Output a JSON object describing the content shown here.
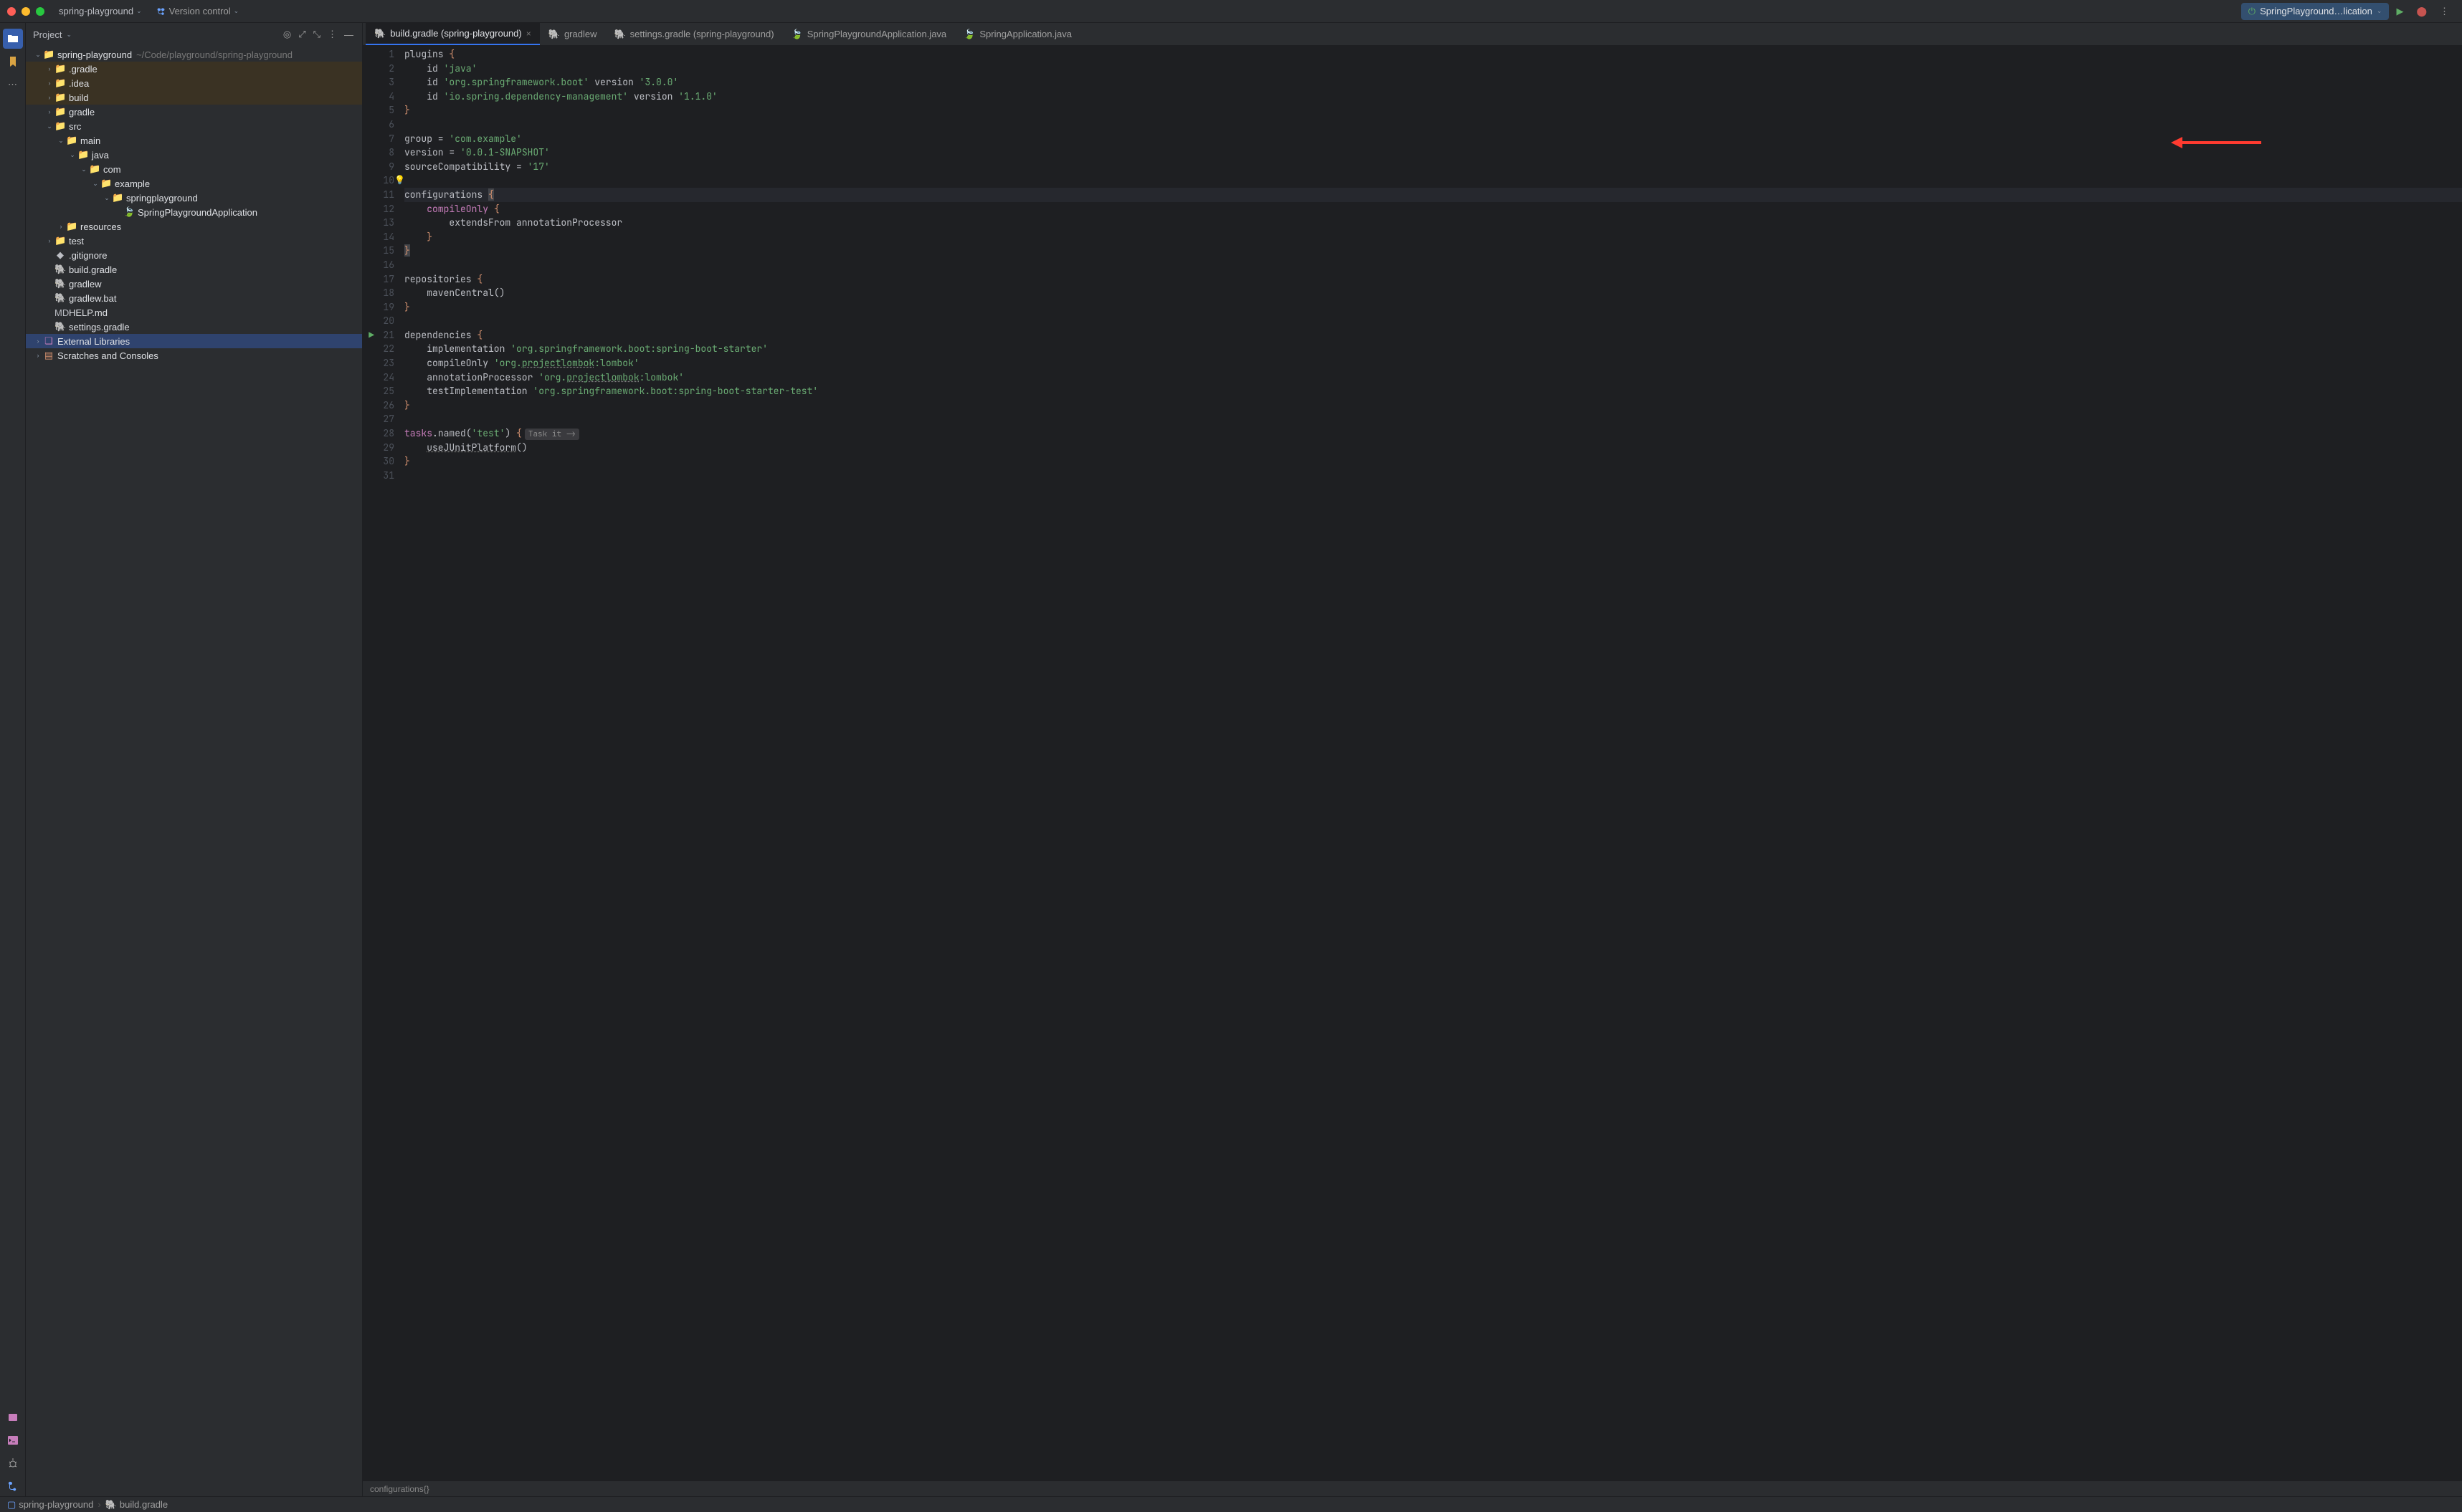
{
  "topbar": {
    "project_name": "spring-playground",
    "vcs_label": "Version control",
    "run_config": "SpringPlayground…lication"
  },
  "project_panel": {
    "title": "Project",
    "root": {
      "label": "spring-playground",
      "path": "~/Code/playground/spring-playground"
    },
    "nodes": [
      {
        "indent": 1,
        "arrow": "right",
        "icon": "📁",
        "label": ".gradle",
        "hl": true
      },
      {
        "indent": 1,
        "arrow": "right",
        "icon": "📁",
        "label": ".idea",
        "hl": true
      },
      {
        "indent": 1,
        "arrow": "right",
        "icon": "📁",
        "label": "build",
        "hl": true
      },
      {
        "indent": 1,
        "arrow": "right",
        "icon": "📁",
        "label": "gradle"
      },
      {
        "indent": 1,
        "arrow": "down",
        "icon": "📁",
        "label": "src"
      },
      {
        "indent": 2,
        "arrow": "down",
        "icon": "📁",
        "label": "main"
      },
      {
        "indent": 3,
        "arrow": "down",
        "icon": "📁",
        "label": "java"
      },
      {
        "indent": 4,
        "arrow": "down",
        "icon": "📁",
        "label": "com"
      },
      {
        "indent": 5,
        "arrow": "down",
        "icon": "📁",
        "label": "example"
      },
      {
        "indent": 6,
        "arrow": "down",
        "icon": "📁",
        "label": "springplayground"
      },
      {
        "indent": 7,
        "arrow": "none",
        "icon": "🍃",
        "label": "SpringPlaygroundApplication"
      },
      {
        "indent": 2,
        "arrow": "right",
        "icon": "📁",
        "label": "resources"
      },
      {
        "indent": 1,
        "arrow": "right",
        "icon": "📁",
        "label": "test"
      },
      {
        "indent": 1,
        "arrow": "none",
        "icon": "◆",
        "label": ".gitignore"
      },
      {
        "indent": 1,
        "arrow": "none",
        "icon": "🐘",
        "label": "build.gradle"
      },
      {
        "indent": 1,
        "arrow": "none",
        "icon": "🐘",
        "label": "gradlew"
      },
      {
        "indent": 1,
        "arrow": "none",
        "icon": "🐘",
        "label": "gradlew.bat"
      },
      {
        "indent": 1,
        "arrow": "none",
        "icon": "MD",
        "label": "HELP.md"
      },
      {
        "indent": 1,
        "arrow": "none",
        "icon": "🐘",
        "label": "settings.gradle"
      }
    ],
    "external_libs": "External Libraries",
    "scratches": "Scratches and Consoles"
  },
  "tabs": [
    {
      "label": "build.gradle (spring-playground)",
      "icon": "🐘",
      "active": true,
      "close": true
    },
    {
      "label": "gradlew",
      "icon": "🐘"
    },
    {
      "label": "settings.gradle (spring-playground)",
      "icon": "🐘"
    },
    {
      "label": "SpringPlaygroundApplication.java",
      "icon": "🍃"
    },
    {
      "label": "SpringApplication.java",
      "icon": "🍃"
    }
  ],
  "code": {
    "lines": [
      {
        "n": 1,
        "html": "<span class='tok-id'>plugins </span><span class='tok-kw'>{</span>"
      },
      {
        "n": 2,
        "html": "    <span class='tok-id'>id </span><span class='tok-str'>'java'</span>"
      },
      {
        "n": 3,
        "html": "    <span class='tok-id'>id </span><span class='tok-str'>'org.springframework.boot'</span> <span class='tok-id'>version </span><span class='tok-str'>'3.0.0'</span>"
      },
      {
        "n": 4,
        "html": "    <span class='tok-id'>id </span><span class='tok-str'>'io.spring.dependency-management'</span> <span class='tok-id'>version </span><span class='tok-str'>'1.1.0'</span>"
      },
      {
        "n": 5,
        "html": "<span class='tok-kw'>}</span>"
      },
      {
        "n": 6,
        "html": ""
      },
      {
        "n": 7,
        "html": "<span class='tok-id'>group = </span><span class='tok-str'>'com.example'</span>"
      },
      {
        "n": 8,
        "html": "<span class='tok-id'>version = </span><span class='tok-str'>'0.0.1-SNAPSHOT'</span>"
      },
      {
        "n": 9,
        "html": "<span class='tok-id'>sourceCompatibility = </span><span class='tok-str'>'17'</span>"
      },
      {
        "n": 10,
        "html": "",
        "bulb": true
      },
      {
        "n": 11,
        "html": "<span class='tok-id'>configurations </span><span class='tok-kw hl-brace'>{</span>",
        "cur": true
      },
      {
        "n": 12,
        "html": "    <span class='tok-fn'>compileOnly</span> <span class='tok-kw'>{</span>"
      },
      {
        "n": 13,
        "html": "        <span class='tok-id'>extendsFrom annotationProcessor</span>"
      },
      {
        "n": 14,
        "html": "    <span class='tok-kw'>}</span>"
      },
      {
        "n": 15,
        "html": "<span class='tok-kw hl-brace'>}</span>"
      },
      {
        "n": 16,
        "html": ""
      },
      {
        "n": 17,
        "html": "<span class='tok-id'>repositories </span><span class='tok-kw'>{</span>"
      },
      {
        "n": 18,
        "html": "    <span class='tok-id'>mavenCentral()</span>"
      },
      {
        "n": 19,
        "html": "<span class='tok-kw'>}</span>"
      },
      {
        "n": 20,
        "html": ""
      },
      {
        "n": 21,
        "html": "<span class='tok-id'>dependencies </span><span class='tok-kw'>{</span>",
        "run": true
      },
      {
        "n": 22,
        "html": "    <span class='tok-id'>implementation </span><span class='tok-str'>'org.springframework.boot:spring-boot-starter'</span>"
      },
      {
        "n": 23,
        "html": "    <span class='tok-id'>compileOnly </span><span class='tok-str'>'org.<span class='tok-under'>projectlombok</span>:lombok'</span>"
      },
      {
        "n": 24,
        "html": "    <span class='tok-id'>annotationProcessor </span><span class='tok-str'>'org.<span class='tok-under'>projectlombok</span>:lombok'</span>"
      },
      {
        "n": 25,
        "html": "    <span class='tok-id'>testImplementation </span><span class='tok-str'>'org.springframework.boot:spring-boot-starter-test'</span>"
      },
      {
        "n": 26,
        "html": "<span class='tok-kw'>}</span>"
      },
      {
        "n": 27,
        "html": ""
      },
      {
        "n": 28,
        "html": "<span class='tok-fn'>tasks</span><span class='tok-id'>.named(</span><span class='tok-str'>'test'</span><span class='tok-id'>) </span><span class='tok-kw'>{</span><span class='hint'>Task it -&gt;</span>"
      },
      {
        "n": 29,
        "html": "    <span class='tok-id tok-under'>useJUnitPlatform</span><span class='tok-id'>()</span>"
      },
      {
        "n": 30,
        "html": "<span class='tok-kw'>}</span>"
      },
      {
        "n": 31,
        "html": ""
      }
    ]
  },
  "crumbs": "configurations{}",
  "breadcrumb": {
    "project": "spring-playground",
    "file": "build.gradle"
  }
}
